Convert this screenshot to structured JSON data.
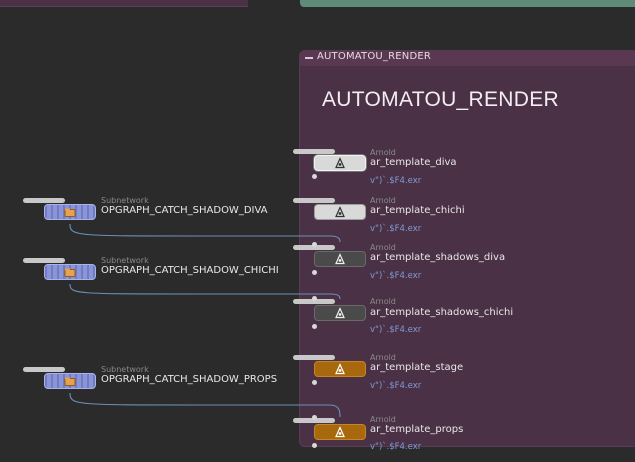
{
  "colors": {
    "background": "#2b2b2b",
    "network_box": "#4a3146",
    "subnetwork_node": "#8a94d8",
    "arnold_light": "#d9d9d9",
    "arnold_dark": "#4a4a4a",
    "arnold_orange": "#a8680e",
    "wire": "#6e8fb8",
    "path_text": "#7f9bd6"
  },
  "network_box": {
    "header_label": "AUTOMATOU_RENDER",
    "title": "AUTOMATOU_RENDER"
  },
  "subnetworks": [
    {
      "type": "Subnetwork",
      "name": "OPGRAPH_CATCH_SHADOW_DIVA",
      "icon": "subnetwork-icon"
    },
    {
      "type": "Subnetwork",
      "name": "OPGRAPH_CATCH_SHADOW_CHICHI",
      "icon": "subnetwork-icon"
    },
    {
      "type": "Subnetwork",
      "name": "OPGRAPH_CATCH_SHADOW_PROPS",
      "icon": "subnetwork-icon"
    }
  ],
  "arnold_nodes": [
    {
      "type": "Arnold",
      "name": "ar_template_diva",
      "path": "v\")`.$F4.exr",
      "style": "light",
      "icon": "arnold-icon",
      "selected": true
    },
    {
      "type": "Arnold",
      "name": "ar_template_chichi",
      "path": "v\")`.$F4.exr",
      "style": "light",
      "icon": "arnold-icon"
    },
    {
      "type": "Arnold",
      "name": "ar_template_shadows_diva",
      "path": "v\")`.$F4.exr",
      "style": "dark",
      "icon": "arnold-icon"
    },
    {
      "type": "Arnold",
      "name": "ar_template_shadows_chichi",
      "path": "v\")`.$F4.exr",
      "style": "dark",
      "icon": "arnold-icon"
    },
    {
      "type": "Arnold",
      "name": "ar_template_stage",
      "path": "v\")`.$F4.exr",
      "style": "orange",
      "icon": "arnold-icon"
    },
    {
      "type": "Arnold",
      "name": "ar_template_props",
      "path": "v\")`.$F4.exr",
      "style": "orange",
      "icon": "arnold-icon"
    }
  ]
}
